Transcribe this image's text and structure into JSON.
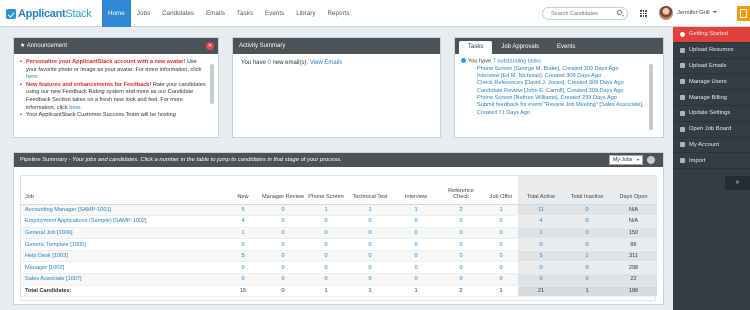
{
  "app": {
    "logo_main": "Applicant",
    "logo_accent": "Stack"
  },
  "nav": [
    "Home",
    "Jobs",
    "Candidates",
    "Emails",
    "Tasks",
    "Events",
    "Library",
    "Reports"
  ],
  "search": {
    "placeholder": "Search Candidates"
  },
  "user": {
    "name": "Jennifer Grill"
  },
  "sidebar": {
    "items": [
      "Getting Started",
      "Upload Resumes",
      "Upload Emails",
      "Manage Users",
      "Manage Billing",
      "Update Settings",
      "Open Job Board",
      "My Account",
      "Import"
    ],
    "toggle": "»"
  },
  "announcement": {
    "title": "Announcement",
    "items": [
      {
        "red": "Personalize your ApplicantStack account with a new avatar!",
        "text": " Use your favorite photo or image as your avatar. For more information, click ",
        "link": "here",
        "tail": "."
      },
      {
        "red": "New features and enhancements for Feedback!",
        "text": " Rate your candidates using our new Feedback Rating system and more as our Candidate Feedback Section takes on a fresh new look and feel. For more information, click ",
        "link": "here",
        "tail": "."
      },
      {
        "red": "",
        "text": "Your ApplicantStack Customer Success Team will be hosting",
        "link": "",
        "tail": ""
      }
    ]
  },
  "activity": {
    "title": "Activity Summary",
    "prefix": "You have ",
    "count": "0",
    "middle": " new email(s). ",
    "link": "View Emails"
  },
  "tasks_panel": {
    "tabs": [
      "Tasks",
      "Job Approvals",
      "Events"
    ],
    "summary_prefix": "You have ",
    "summary_link": "7 outstanding tasks",
    "items": [
      "Phone Screen [George M. Blake], Created 309 Days Ago",
      "Interview [Ed M. Nicholas], Created 309 Days Ago",
      "Check References [David J. Jones], Created 309 Days Ago",
      "Candidate Review [John E. Carroll], Created 309 Days Ago",
      "Phone Screen [Nathen Williams], Created 299 Days Ago",
      "Submit feedback for event \"Review Job Meeting\" [Sales Associate], Created 71 Days Ago"
    ]
  },
  "pipeline": {
    "title": "Pipeline Summary",
    "subtitle": " - Your jobs and candidates. Click a number in the table to jump to candidates in that stage of your process.",
    "filter": "My Jobs",
    "columns": [
      "Job",
      "New",
      "Manager Review",
      "Phone Screen",
      "Technical Test",
      "Interview",
      "Reference Check",
      "Job Offer",
      "Total Active",
      "Total Inactive",
      "Days Open"
    ],
    "rows": [
      [
        "Accounting Manager [SAMP-1001]",
        "5",
        "0",
        "1",
        "1",
        "1",
        "2",
        "1",
        "11",
        "0",
        "N/A"
      ],
      [
        "Employment Applications (Sample) [SAMP-1002]",
        "4",
        "0",
        "0",
        "0",
        "0",
        "0",
        "0",
        "4",
        "0",
        "N/A"
      ],
      [
        "General Job [1006]",
        "1",
        "0",
        "0",
        "0",
        "0",
        "0",
        "0",
        "1",
        "0",
        "150"
      ],
      [
        "Generic Template [1005]",
        "0",
        "0",
        "0",
        "0",
        "0",
        "0",
        "0",
        "0",
        "0",
        "86"
      ],
      [
        "Help Desk [1003]",
        "5",
        "0",
        "0",
        "0",
        "0",
        "0",
        "0",
        "5",
        "1",
        "311"
      ],
      [
        "Manager [1002]",
        "0",
        "0",
        "0",
        "0",
        "0",
        "0",
        "0",
        "0",
        "0",
        "298"
      ],
      [
        "Sales Associate [1007]",
        "0",
        "0",
        "0",
        "0",
        "0",
        "0",
        "0",
        "0",
        "0",
        "22"
      ]
    ],
    "total": [
      "Total Candidates:",
      "15",
      "0",
      "1",
      "1",
      "1",
      "2",
      "1",
      "21",
      "1",
      "188"
    ]
  }
}
